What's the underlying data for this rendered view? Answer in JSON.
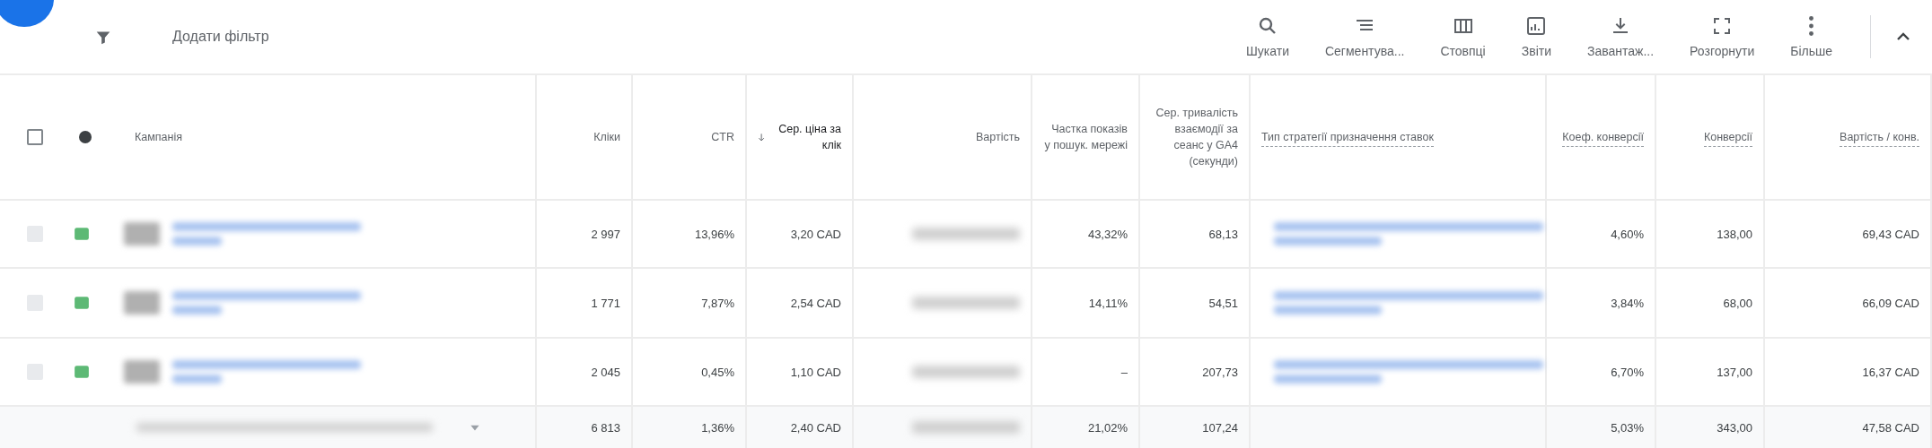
{
  "toolbar": {
    "add_filter": "Додати фільтр",
    "actions": [
      {
        "kind": "search",
        "label": "Шукати"
      },
      {
        "kind": "segment",
        "label": "Сегментува..."
      },
      {
        "kind": "columns",
        "label": "Стовпці"
      },
      {
        "kind": "reports",
        "label": "Звіти"
      },
      {
        "kind": "download",
        "label": "Завантаж..."
      },
      {
        "kind": "expand",
        "label": "Розгорнути"
      },
      {
        "kind": "more",
        "label": "Більше"
      }
    ]
  },
  "table": {
    "select_all": {
      "checked": false
    },
    "columns": [
      {
        "label": "Кампанія",
        "underlined": false,
        "sorted": false
      },
      {
        "label": "Кліки",
        "underlined": false,
        "sorted": false
      },
      {
        "label": "CTR",
        "underlined": false,
        "sorted": false
      },
      {
        "label": "Сер. ціна за клік",
        "underlined": false,
        "sorted": true
      },
      {
        "label": "Вартість",
        "underlined": false,
        "sorted": false
      },
      {
        "label": "Частка показів у пошук. мережі",
        "underlined": false,
        "sorted": false
      },
      {
        "label": "Сер. тривалість взаємодії за сеанс у GA4 (секунди)",
        "underlined": false,
        "sorted": false
      },
      {
        "label": "Тип стратегії призначення ставок",
        "underlined": true,
        "sorted": false
      },
      {
        "label": "Коеф. конверсії",
        "underlined": true,
        "sorted": false
      },
      {
        "label": "Конверсії",
        "underlined": true,
        "sorted": false
      },
      {
        "label": "Вартість / конв.",
        "underlined": true,
        "sorted": false
      }
    ],
    "rows": [
      {
        "checked": false,
        "disabled": true,
        "clicks": "2 997",
        "ctr": "13,96%",
        "cpc": "3,20 CAD",
        "share": "43,32%",
        "duration": "68,13",
        "conv_rate": "4,60%",
        "conversions": "138,00",
        "cost_per_conv": "69,43 CAD"
      },
      {
        "checked": false,
        "disabled": true,
        "clicks": "1 771",
        "ctr": "7,87%",
        "cpc": "2,54 CAD",
        "share": "14,11%",
        "duration": "54,51",
        "conv_rate": "3,84%",
        "conversions": "68,00",
        "cost_per_conv": "66,09 CAD"
      },
      {
        "checked": false,
        "disabled": true,
        "clicks": "2 045",
        "ctr": "0,45%",
        "cpc": "1,10 CAD",
        "share": "–",
        "duration": "207,73",
        "conv_rate": "6,70%",
        "conversions": "137,00",
        "cost_per_conv": "16,37 CAD"
      }
    ],
    "total": {
      "clicks": "6 813",
      "ctr": "1,36%",
      "cpc": "2,40 CAD",
      "share": "21,02%",
      "duration": "107,24",
      "conv_rate": "5,03%",
      "conversions": "343,00",
      "cost_per_conv": "47,58 CAD"
    }
  }
}
